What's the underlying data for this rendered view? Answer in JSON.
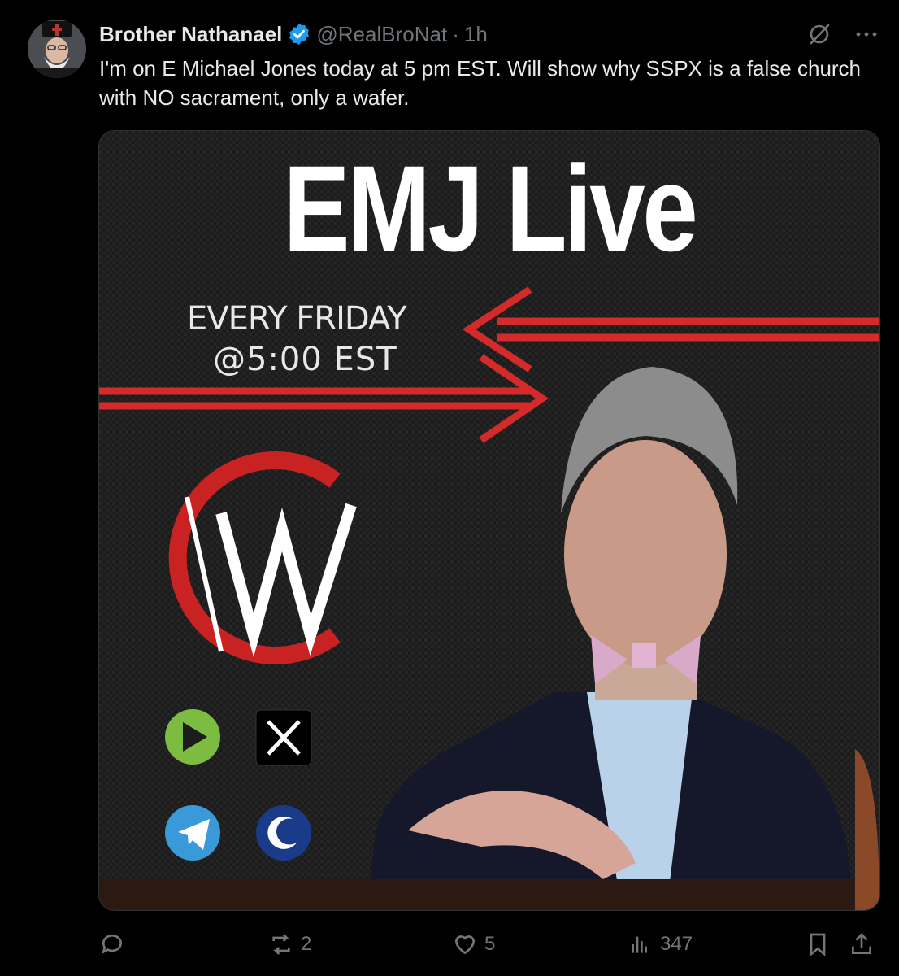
{
  "post": {
    "author_name": "Brother Nathanael",
    "handle": "@RealBroNat",
    "separator": "·",
    "time": "1h",
    "text": "I'm on E Michael Jones today at 5 pm EST. Will show why SSPX is a false church with NO sacrament, only a wafer.",
    "more_icon": "more-icon",
    "grok_icon": "grok-icon"
  },
  "media": {
    "title": "EMJ Live",
    "line1": "EVERY  FRIDAY",
    "line2": "@5:00  EST",
    "accent_red": "#d42a2a",
    "logo_icon": "cw-logo-icon",
    "platform_icons": [
      "rumble-icon",
      "x-icon",
      "telegram-icon",
      "odysee-icon"
    ]
  },
  "actions": {
    "reply_count": "",
    "repost_count": "2",
    "like_count": "5",
    "views_count": "347"
  },
  "colors": {
    "background": "#000000",
    "text": "#e7e9ea",
    "muted": "#71767b",
    "verified": "#1d9bf0"
  }
}
